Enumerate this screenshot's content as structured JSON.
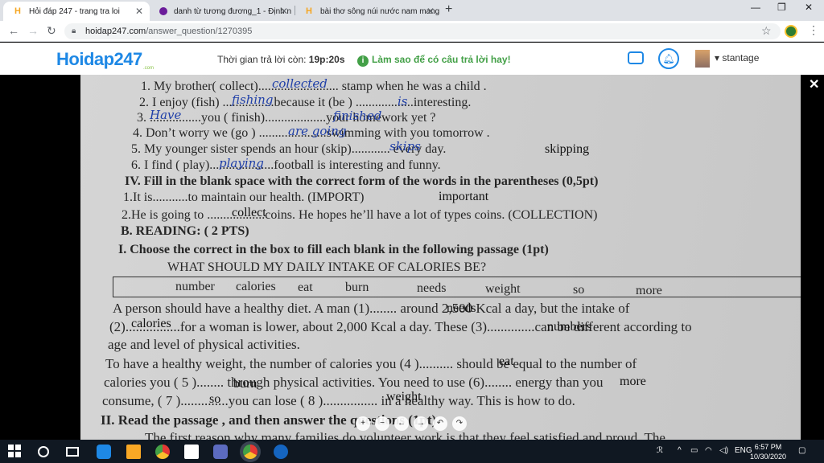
{
  "browser": {
    "tabs": [
      {
        "title": "Hỏi đáp 247 - trang tra loi",
        "icon": "hoidap-icon"
      },
      {
        "title": "danh từ tương đương_1 - Định n",
        "icon": "dict-icon"
      },
      {
        "title": "bài thơ sông núi nước nam mang",
        "icon": "hoidap-icon"
      }
    ],
    "url_domain": "hoidap247.com",
    "url_path": "/answer_question/1270395"
  },
  "site": {
    "logo_main": "Hoidap247",
    "logo_sub": ".com",
    "timer_label": "Thời gian trả lời còn:",
    "timer_value": "19p:20s",
    "howto": "Làm sao để có câu trả lời hay!",
    "username": "stantage"
  },
  "worksheet": {
    "lines": [
      "1. My brother( collect)......................... stamp when he was a child .",
      "2. I enjoy (fish) ................because it (be ) ..................interesting.",
      "3. ................you ( finish)...................your homework yet ?",
      "4. Don’t worry we (go ) .....................swimming with you tomorrow .",
      "5. My younger sister spends an hour (skip)............ every day.",
      "6. I find ( play)....................football is interesting and funny.",
      "IV. Fill in the  blank space with the correct form of the words in the parentheses (0,5pt)",
      "1.It is...........to maintain our health. (IMPORT)",
      "2.He is going to ..................coins. He hopes he’ll have a lot of types coins. (COLLECTION)",
      "B. READING: ( 2 PTS)",
      "I. Choose the correct  in the box to fill  each  blank in  the following passage (1pt)",
      "WHAT SHOULD MY DAILY INTAKE OF CALORIES BE?",
      "A person should have a healthy diet. A man (1)........ around 2,500 Kcal a day, but the intake of",
      "(2)................for a woman is lower, about 2,000 Kcal a day. These (3)..............can be different according to",
      "age and level of physical activities.",
      "To have a healthy weight, the number of calories you (4 ).......... should be equal to the number of",
      "calories you ( 5 )........ through physical activities. You need to use (6)........ energy than you",
      "consume, ( 7 )..............you can lose ( 8 )................ in a healthy way. This is how to do.",
      "II. Read the passage , and then answer the questions (1pt)",
      "The first reason why many families do volunteer work is that they feel satisfied and proud. The"
    ],
    "box_words": [
      "number",
      "calories",
      "eat",
      "burn",
      "needs",
      "weight",
      "so",
      "more"
    ],
    "handwritten": [
      "collected",
      "fishing",
      "is",
      "Have",
      "finished",
      "are going",
      "skips",
      "playing"
    ],
    "typed_answers": [
      "skipping",
      "important",
      "collect",
      "needs",
      "calories",
      "numbers",
      "eat",
      "burn",
      "more",
      "so",
      "weight"
    ]
  },
  "taskbar": {
    "lang": "ENG",
    "time": "6:57 PM",
    "date": "10/30/2020"
  }
}
